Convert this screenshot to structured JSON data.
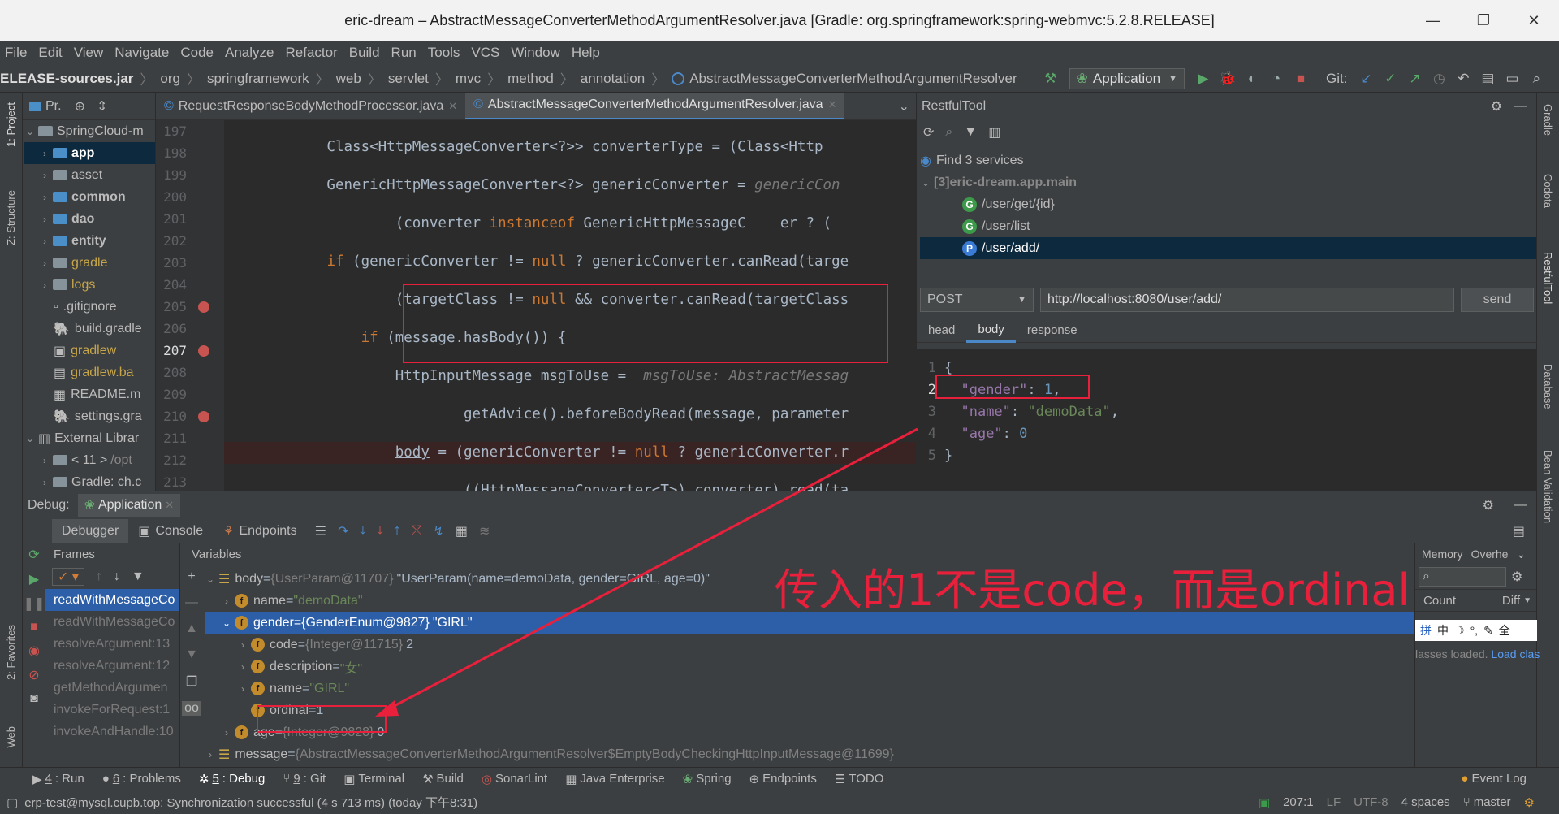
{
  "window": {
    "title": "eric-dream – AbstractMessageConverterMethodArgumentResolver.java [Gradle: org.springframework:spring-webmvc:5.2.8.RELEASE]",
    "min_icon": "—",
    "max_icon": "❐",
    "close_icon": "✕"
  },
  "menu": [
    "File",
    "Edit",
    "View",
    "Navigate",
    "Code",
    "Analyze",
    "Refactor",
    "Build",
    "Run",
    "Tools",
    "VCS",
    "Window",
    "Help"
  ],
  "breadcrumb": [
    "ELEASE-sources.jar",
    "org",
    "springframework",
    "web",
    "servlet",
    "mvc",
    "method",
    "annotation",
    "AbstractMessageConverterMethodArgumentResolver"
  ],
  "toolbar": {
    "run_config": "Application",
    "git_label": "Git:"
  },
  "project": {
    "header": "Pr.",
    "items": [
      {
        "label": "SpringCloud-m",
        "num": "197"
      },
      {
        "label": "app"
      },
      {
        "label": "asset"
      },
      {
        "label": "common"
      },
      {
        "label": "dao"
      },
      {
        "label": "entity"
      },
      {
        "label": "gradle"
      },
      {
        "label": "logs"
      },
      {
        "label": ".gitignore"
      },
      {
        "label": "build.gradle"
      },
      {
        "label": "gradlew"
      },
      {
        "label": "gradlew.ba"
      },
      {
        "label": "README.m"
      },
      {
        "label": "settings.gra"
      },
      {
        "label": "External Librar"
      },
      {
        "label": "< 11 >",
        "suffix": "/opt"
      },
      {
        "label": "Gradle: ch.c"
      }
    ]
  },
  "editor": {
    "tabs": [
      {
        "label": "RequestResponseBodyMethodProcessor.java"
      },
      {
        "label": "AbstractMessageConverterMethodArgumentResolver.java"
      }
    ],
    "lines": [
      "197",
      "198",
      "199",
      "200",
      "201",
      "202",
      "203",
      "204",
      "205",
      "206",
      "207",
      "208",
      "209",
      "210",
      "211",
      "212",
      "213"
    ]
  },
  "restful": {
    "title": "RestfulTool",
    "find": "Find 3 services",
    "module": "[3]eric-dream.app.main",
    "services": [
      {
        "badge": "G",
        "path": "/user/get/{id}"
      },
      {
        "badge": "G",
        "path": "/user/list"
      },
      {
        "badge": "P",
        "path": "/user/add/"
      }
    ],
    "method": "POST",
    "url": "http://localhost:8080/user/add/",
    "send": "send",
    "tabs": [
      "head",
      "body",
      "response"
    ],
    "body_lines": [
      "1",
      "2",
      "3",
      "4",
      "5"
    ]
  },
  "debug": {
    "label": "Debug:",
    "config": "Application",
    "tabs": [
      "Debugger",
      "Console",
      "Endpoints"
    ],
    "frames_label": "Frames",
    "variables_label": "Variables",
    "frames": [
      "readWithMessageCo",
      "readWithMessageCo",
      "resolveArgument:13",
      "resolveArgument:12",
      "getMethodArgumen",
      "invokeForRequest:1",
      "invokeAndHandle:10"
    ],
    "memory": {
      "tab1": "Memory",
      "tab2": "Overhe",
      "count": "Count",
      "diff": "Diff",
      "loaded": "lasses loaded.",
      "load_link": "Load clas"
    },
    "ime": [
      "拼",
      "中",
      "☽",
      "°,",
      "✎",
      "全"
    ],
    "annotation": "传入的1不是code，而是ordinal",
    "vars": [
      {
        "name": "body",
        "type": "{UserParam@11707}",
        "value": "\"UserParam(name=demoData, gender=GIRL, age=0)\""
      },
      {
        "name": "name",
        "value": "\"demoData\""
      },
      {
        "name": "gender",
        "type": "{GenderEnum@9827}",
        "value": "\"GIRL\""
      },
      {
        "name": "code",
        "type": "{Integer@11715}",
        "value": "2"
      },
      {
        "name": "description",
        "value": "\"女\""
      },
      {
        "name": "name",
        "value": "\"GIRL\""
      },
      {
        "name": "ordinal",
        "value": "1"
      },
      {
        "name": "age",
        "type": "{Integer@9828}",
        "value": "0"
      },
      {
        "name": "message",
        "type": "{AbstractMessageConverterMethodArgumentResolver$EmptyBodyCheckingHttpInputMessage@11699}",
        "value": ""
      }
    ]
  },
  "toolwindows": [
    {
      "num": "4",
      "label": ": Run"
    },
    {
      "num": "6",
      "label": ": Problems"
    },
    {
      "num": "5",
      "label": ": Debug"
    },
    {
      "num": "9",
      "label": ": Git"
    },
    {
      "label": "Terminal"
    },
    {
      "label": "Build"
    },
    {
      "label": "SonarLint"
    },
    {
      "label": "Java Enterprise"
    },
    {
      "label": "Spring"
    },
    {
      "label": "Endpoints"
    },
    {
      "label": "TODO"
    },
    {
      "label": "Event Log"
    }
  ],
  "status": {
    "message": "erp-test@mysql.cupb.top: Synchronization successful (4 s 713 ms) (today 下午8:31)",
    "position": "207:1",
    "line_sep": "LF",
    "encoding": "UTF-8",
    "indent": "4 spaces",
    "branch": "master"
  },
  "side_labels": {
    "left": [
      "1: Project",
      "Z: Structure",
      "2: Favorites",
      "Web"
    ],
    "right": [
      "Gradle",
      "Codota",
      "RestfulTool",
      "Database",
      "Bean Validation"
    ]
  },
  "colors": {
    "accent": "#2d5fa8",
    "annotation": "#e8203c",
    "keyword": "#cc7832",
    "string": "#6a8759"
  }
}
